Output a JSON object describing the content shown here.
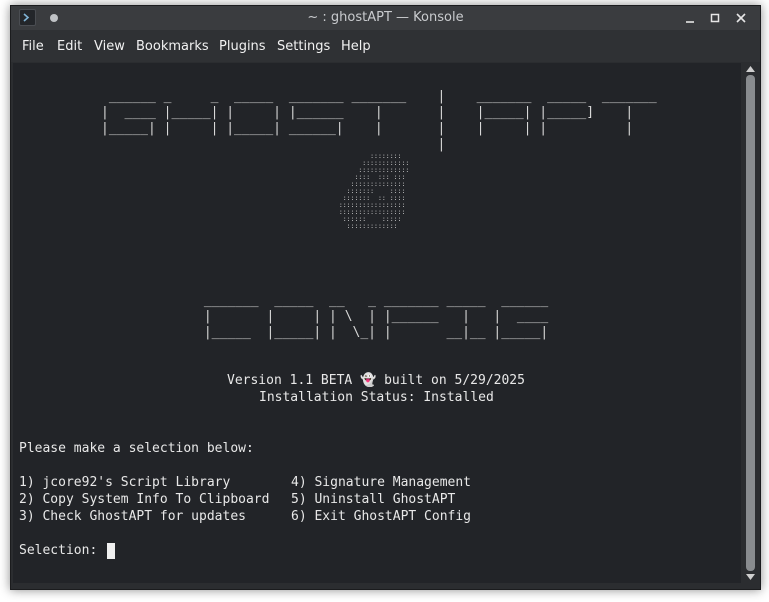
{
  "window": {
    "title": "~ : ghostAPT — Konsole"
  },
  "menu": [
    "File",
    "Edit",
    "View",
    "Bookmarks",
    "Plugins",
    "Settings",
    "Help"
  ],
  "icons": {
    "app": "konsole-icon",
    "pin": "pin-icon",
    "minimize": "minimize-icon",
    "maximize": "maximize-icon",
    "close": "close-icon"
  },
  "terminal": {
    "banner_top": " ______ _     _  _____  _______ _______    |    _______  _____  _______\n|  ____ |_____| |     | |______    |       |    |_____| |_____]    |   \n|_____| |     | |_____| ______|    |       |    |     | |          |   \n                                           |                            ",
    "ghost_art": "          ::::::::\n        ::::::::::::\n       :::::::::::::\n      ::::  ::: :::\n     ::::::::::::::\n    :::::::    ::::\n   :::::::  :: ::::\n  :::::::::::::::::\n  :::::::::::::::::\n   ::::::    :::::\n    :::::::::::::",
    "banner_bottom": " _______  _____  __   _ _______ _____  ______\n |       |     | | \\  | |______   |   |  ____\n |_____  |_____| |  \\_| |       __|__ |_____|",
    "version_line": "Version 1.1 BETA 👻 built on 5/29/2025",
    "status_line": "Installation Status: Installed",
    "prompt_heading": "Please make a selection below:",
    "options_left": [
      "1) jcore92's Script Library",
      "2) Copy System Info To Clipboard",
      "3) Check GhostAPT for updates"
    ],
    "options_right": [
      "4) Signature Management",
      "5) Uninstall GhostAPT",
      "6) Exit GhostAPT Config"
    ],
    "selection_prompt": "Selection: "
  }
}
